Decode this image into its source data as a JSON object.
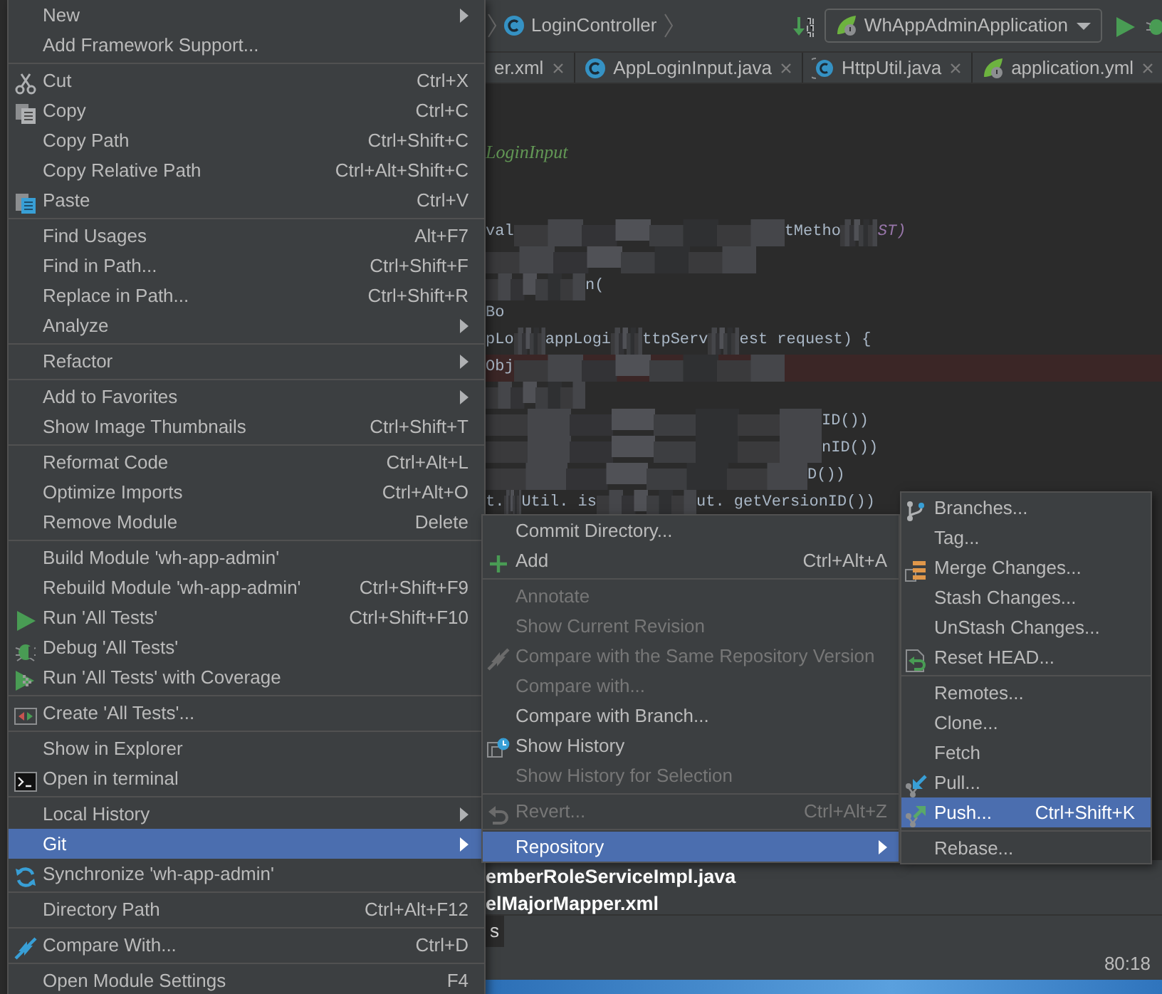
{
  "toolbar": {
    "breadcrumb": "LoginController",
    "run_config": "WhAppAdminApplication"
  },
  "tabs": [
    {
      "label": "er.xml",
      "selected": false
    },
    {
      "label": "AppLoginInput.java",
      "selected": false
    },
    {
      "label": "HttpUtil.java",
      "selected": false
    },
    {
      "label": "application.yml",
      "selected": false
    }
  ],
  "editor": {
    "lines": [
      {
        "kind": "blank"
      },
      {
        "kind": "blank"
      },
      {
        "kind": "code",
        "parts": [
          {
            "kind": "comment",
            "text": "LoginInput"
          }
        ]
      },
      {
        "kind": "blank"
      },
      {
        "kind": "blank"
      },
      {
        "kind": "code",
        "parts": [
          {
            "kind": "text",
            "text": "val"
          },
          {
            "kind": "blur"
          },
          {
            "kind": "text",
            "text": "tMetho"
          },
          {
            "kind": "blur"
          },
          {
            "kind": "constant",
            "text": "ST)"
          }
        ]
      },
      {
        "kind": "code",
        "parts": [
          {
            "kind": "blur"
          }
        ]
      },
      {
        "kind": "code",
        "parts": [
          {
            "kind": "blur"
          },
          {
            "kind": "text",
            "text": "n("
          }
        ]
      },
      {
        "kind": "code",
        "parts": [
          {
            "kind": "text",
            "text": "Bo"
          }
        ]
      },
      {
        "kind": "code",
        "parts": [
          {
            "kind": "text",
            "text": "pLo"
          },
          {
            "kind": "blur"
          },
          {
            "kind": "text",
            "text": "appLogi"
          },
          {
            "kind": "blur"
          },
          {
            "kind": "text",
            "text": "ttpServ"
          },
          {
            "kind": "blur"
          },
          {
            "kind": "text",
            "text": "est request) {"
          }
        ]
      },
      {
        "kind": "code",
        "highlighted": true,
        "parts": [
          {
            "kind": "text",
            "text": "Obj"
          },
          {
            "kind": "blur"
          }
        ]
      },
      {
        "kind": "code",
        "parts": [
          {
            "kind": "blur"
          }
        ]
      },
      {
        "kind": "code",
        "parts": [
          {
            "kind": "blur"
          },
          {
            "kind": "text",
            "text": "ID())"
          }
        ]
      },
      {
        "kind": "code",
        "parts": [
          {
            "kind": "blur"
          },
          {
            "kind": "text",
            "text": "nID())"
          }
        ]
      },
      {
        "kind": "code",
        "parts": [
          {
            "kind": "blur"
          },
          {
            "kind": "text",
            "text": "D())"
          }
        ]
      },
      {
        "kind": "code",
        "parts": [
          {
            "kind": "text",
            "text": "t."
          },
          {
            "kind": "blur"
          },
          {
            "kind": "text",
            "text": "Util. is"
          },
          {
            "kind": "blur"
          },
          {
            "kind": "text",
            "text": "ut. getVersionID())"
          }
        ]
      }
    ]
  },
  "changes_panel": {
    "files": [
      "emberRoleServiceImpl.java",
      "elMajorMapper.xml"
    ]
  },
  "tool_tabs": [
    {
      "label": "s",
      "selected": true
    }
  ],
  "status_bar": {
    "position": "80:18"
  },
  "context_menu": {
    "groups": [
      {
        "items": [
          {
            "label": "New",
            "submenu": true,
            "selected": false
          },
          {
            "label": "Add Framework Support...",
            "submenu": false,
            "selected": false
          }
        ]
      },
      {
        "items": [
          {
            "label": "Cut",
            "shortcut": "Ctrl+X",
            "submenu": false,
            "selected": false
          },
          {
            "label": "Copy",
            "shortcut": "Ctrl+C",
            "submenu": false,
            "selected": false
          },
          {
            "label": "Copy Path",
            "shortcut": "Ctrl+Shift+C",
            "submenu": false,
            "selected": false
          },
          {
            "label": "Copy Relative Path",
            "shortcut": "Ctrl+Alt+Shift+C",
            "submenu": false,
            "selected": false
          },
          {
            "label": "Paste",
            "shortcut": "Ctrl+V",
            "submenu": false,
            "selected": false
          }
        ]
      },
      {
        "items": [
          {
            "label": "Find Usages",
            "shortcut": "Alt+F7",
            "submenu": false,
            "selected": false
          },
          {
            "label": "Find in Path...",
            "shortcut": "Ctrl+Shift+F",
            "submenu": false,
            "selected": false
          },
          {
            "label": "Replace in Path...",
            "shortcut": "Ctrl+Shift+R",
            "submenu": false,
            "selected": false
          },
          {
            "label": "Analyze",
            "submenu": true,
            "selected": false
          }
        ]
      },
      {
        "items": [
          {
            "label": "Refactor",
            "submenu": true,
            "selected": false
          }
        ]
      },
      {
        "items": [
          {
            "label": "Add to Favorites",
            "submenu": true,
            "selected": false
          },
          {
            "label": "Show Image Thumbnails",
            "shortcut": "Ctrl+Shift+T",
            "submenu": false,
            "selected": false
          }
        ]
      },
      {
        "items": [
          {
            "label": "Reformat Code",
            "shortcut": "Ctrl+Alt+L",
            "submenu": false,
            "selected": false
          },
          {
            "label": "Optimize Imports",
            "shortcut": "Ctrl+Alt+O",
            "submenu": false,
            "selected": false
          },
          {
            "label": "Remove Module",
            "shortcut": "Delete",
            "submenu": false,
            "selected": false
          }
        ]
      },
      {
        "items": [
          {
            "label": "Build Module 'wh-app-admin'",
            "submenu": false,
            "selected": false
          },
          {
            "label": "Rebuild Module 'wh-app-admin'",
            "shortcut": "Ctrl+Shift+F9",
            "submenu": false,
            "selected": false
          },
          {
            "label": "Run 'All Tests'",
            "shortcut": "Ctrl+Shift+F10",
            "submenu": false,
            "selected": false
          },
          {
            "label": "Debug 'All Tests'",
            "submenu": false,
            "selected": false
          },
          {
            "label": "Run 'All Tests' with Coverage",
            "submenu": false,
            "selected": false
          }
        ]
      },
      {
        "items": [
          {
            "label": "Create 'All Tests'...",
            "submenu": false,
            "selected": false
          }
        ]
      },
      {
        "items": [
          {
            "label": "Show in Explorer",
            "submenu": false,
            "selected": false
          },
          {
            "label": "Open in terminal",
            "submenu": false,
            "selected": false
          }
        ]
      },
      {
        "items": [
          {
            "label": "Local History",
            "submenu": true,
            "selected": false
          },
          {
            "label": "Git",
            "submenu": true,
            "selected": true
          },
          {
            "label": "Synchronize 'wh-app-admin'",
            "submenu": false,
            "selected": false
          }
        ]
      },
      {
        "items": [
          {
            "label": "Directory Path",
            "shortcut": "Ctrl+Alt+F12",
            "submenu": false,
            "selected": false
          }
        ]
      },
      {
        "items": [
          {
            "label": "Compare With...",
            "shortcut": "Ctrl+D",
            "submenu": false,
            "selected": false
          }
        ]
      },
      {
        "items": [
          {
            "label": "Open Module Settings",
            "shortcut": "F4",
            "submenu": false,
            "selected": false
          }
        ]
      }
    ]
  },
  "git_submenu": {
    "groups": [
      {
        "items": [
          {
            "label": "Commit Directory...",
            "submenu": false,
            "disabled": false,
            "selected": false
          },
          {
            "label": "Add",
            "shortcut": "Ctrl+Alt+A",
            "submenu": false,
            "disabled": false,
            "selected": false
          }
        ]
      },
      {
        "items": [
          {
            "label": "Annotate",
            "submenu": false,
            "disabled": true,
            "selected": false
          },
          {
            "label": "Show Current Revision",
            "submenu": false,
            "disabled": true,
            "selected": false
          },
          {
            "label": "Compare with the Same Repository Version",
            "submenu": false,
            "disabled": true,
            "selected": false
          },
          {
            "label": "Compare with...",
            "submenu": false,
            "disabled": true,
            "selected": false
          },
          {
            "label": "Compare with Branch...",
            "submenu": false,
            "disabled": false,
            "selected": false
          },
          {
            "label": "Show History",
            "submenu": false,
            "disabled": false,
            "selected": false
          },
          {
            "label": "Show History for Selection",
            "submenu": false,
            "disabled": true,
            "selected": false
          }
        ]
      },
      {
        "items": [
          {
            "label": "Revert...",
            "shortcut": "Ctrl+Alt+Z",
            "submenu": false,
            "disabled": true,
            "selected": false
          }
        ]
      },
      {
        "items": [
          {
            "label": "Repository",
            "submenu": true,
            "disabled": false,
            "selected": true
          }
        ]
      }
    ]
  },
  "repository_submenu": {
    "groups": [
      {
        "items": [
          {
            "label": "Branches...",
            "submenu": false,
            "selected": false
          },
          {
            "label": "Tag...",
            "submenu": false,
            "selected": false
          },
          {
            "label": "Merge Changes...",
            "submenu": false,
            "selected": false
          },
          {
            "label": "Stash Changes...",
            "submenu": false,
            "selected": false
          },
          {
            "label": "UnStash Changes...",
            "submenu": false,
            "selected": false
          },
          {
            "label": "Reset HEAD...",
            "submenu": false,
            "selected": false
          }
        ]
      },
      {
        "items": [
          {
            "label": "Remotes...",
            "submenu": false,
            "selected": false
          },
          {
            "label": "Clone...",
            "submenu": false,
            "selected": false
          },
          {
            "label": "Fetch",
            "submenu": false,
            "selected": false
          },
          {
            "label": "Pull...",
            "submenu": false,
            "selected": false
          },
          {
            "label": "Push...",
            "shortcut": "Ctrl+Shift+K",
            "submenu": false,
            "selected": true
          }
        ]
      },
      {
        "items": [
          {
            "label": "Rebase...",
            "submenu": false,
            "selected": false
          }
        ]
      }
    ]
  }
}
